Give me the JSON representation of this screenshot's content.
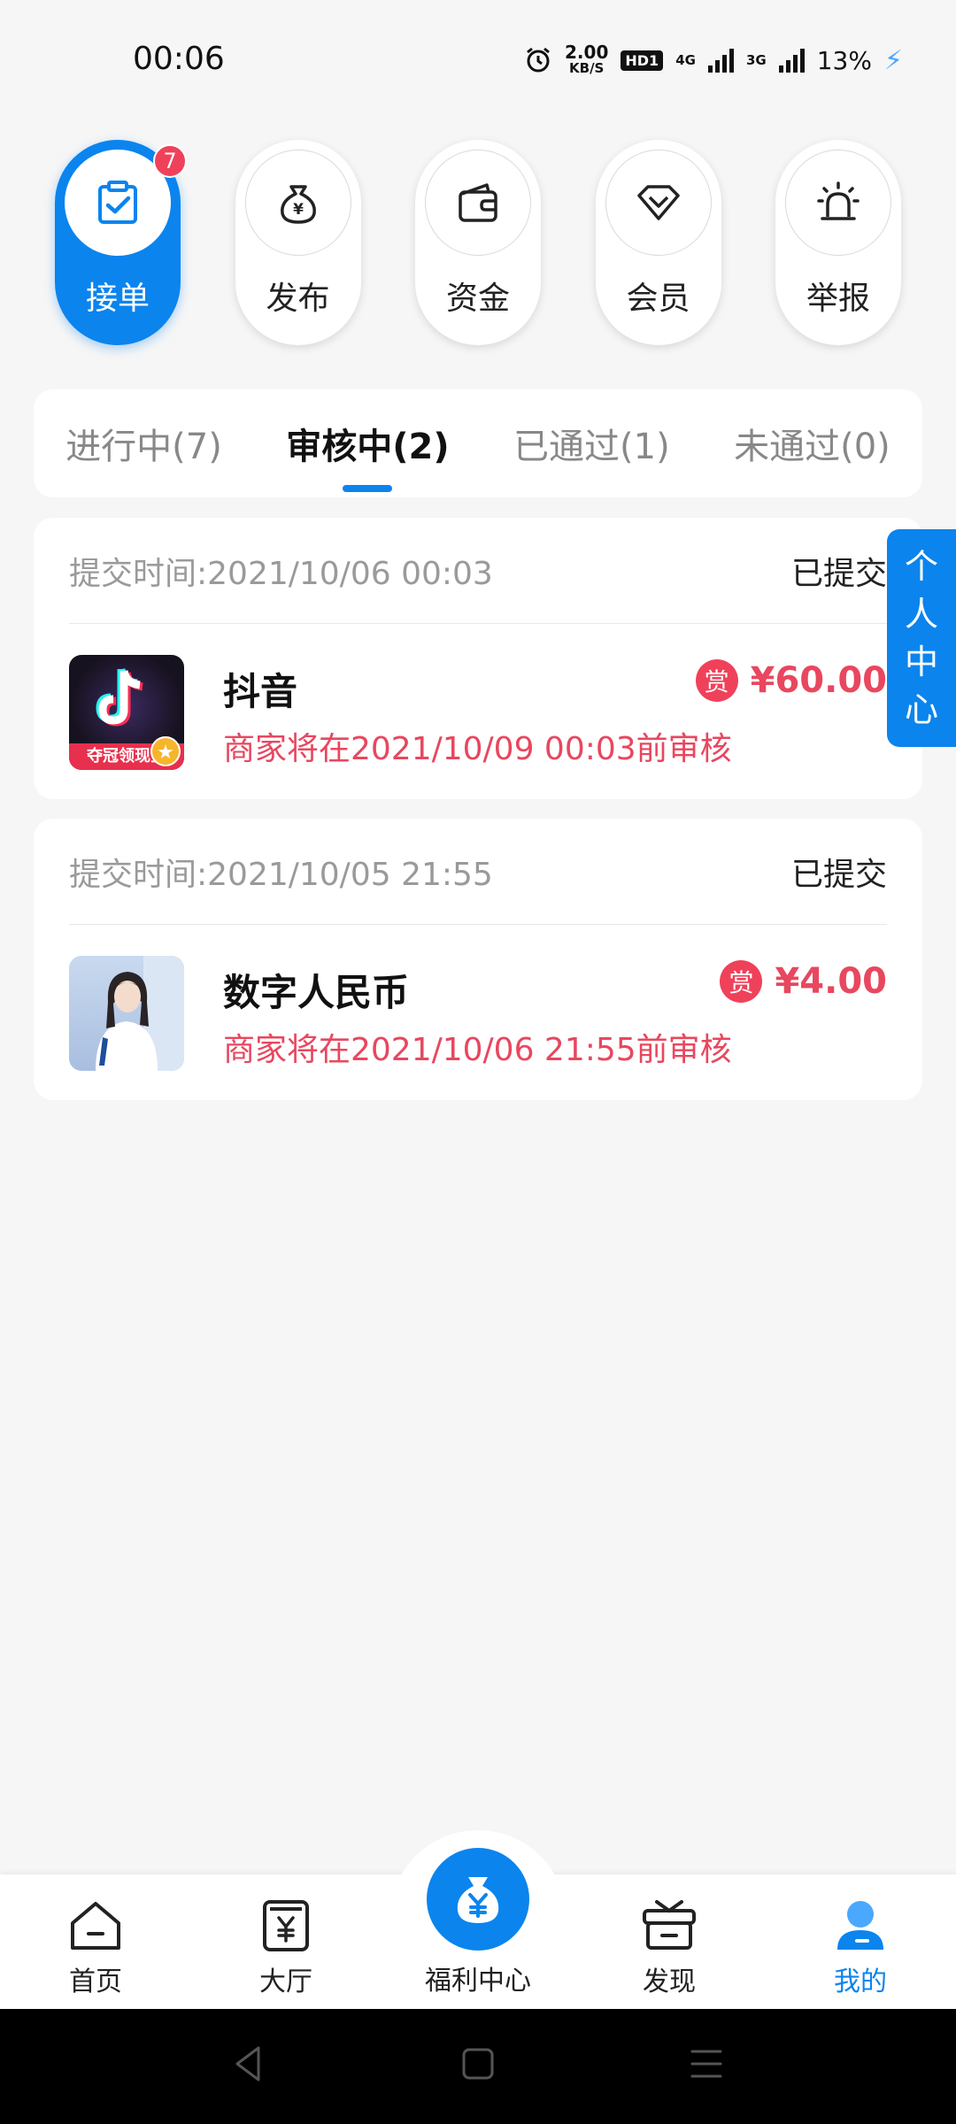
{
  "status_bar": {
    "time": "00:06",
    "speed_value": "2.00",
    "speed_unit": "KB/S",
    "hd": "HD1",
    "net1": "4G",
    "net2": "3G",
    "battery": "13%"
  },
  "categories": [
    {
      "label": "接单",
      "icon": "clipboard-check-icon",
      "badge": "7",
      "active": true
    },
    {
      "label": "发布",
      "icon": "money-bag-icon"
    },
    {
      "label": "资金",
      "icon": "wallet-icon"
    },
    {
      "label": "会员",
      "icon": "diamond-icon"
    },
    {
      "label": "举报",
      "icon": "alarm-siren-icon"
    }
  ],
  "tabs": [
    {
      "label": "进行中(7)"
    },
    {
      "label": "审核中(2)",
      "active": true
    },
    {
      "label": "已通过(1)"
    },
    {
      "label": "未通过(0)"
    }
  ],
  "tasks": [
    {
      "submit_time": "提交时间:2021/10/06 00:03",
      "status": "已提交",
      "name": "抖音",
      "reward_icon": "赏",
      "reward": "¥60.00",
      "deadline": "商家将在2021/10/09 00:03前审核",
      "thumb_text": "夺冠领现金"
    },
    {
      "submit_time": "提交时间:2021/10/05 21:55",
      "status": "已提交",
      "name": "数字人民币",
      "reward_icon": "赏",
      "reward": "¥4.00",
      "deadline": "商家将在2021/10/06 21:55前审核"
    }
  ],
  "side_float": {
    "chars": [
      "个",
      "人",
      "中",
      "心"
    ]
  },
  "bottom_nav": [
    {
      "label": "首页",
      "icon": "home-icon"
    },
    {
      "label": "大厅",
      "icon": "yuan-card-icon"
    },
    {
      "label": "福利中心",
      "icon": "money-bag-icon",
      "center": true
    },
    {
      "label": "发现",
      "icon": "gift-box-icon"
    },
    {
      "label": "我的",
      "icon": "user-icon",
      "active": true
    }
  ],
  "colors": {
    "accent": "#0b84ee",
    "reward": "#e8475f",
    "background": "#f6f6f6"
  }
}
